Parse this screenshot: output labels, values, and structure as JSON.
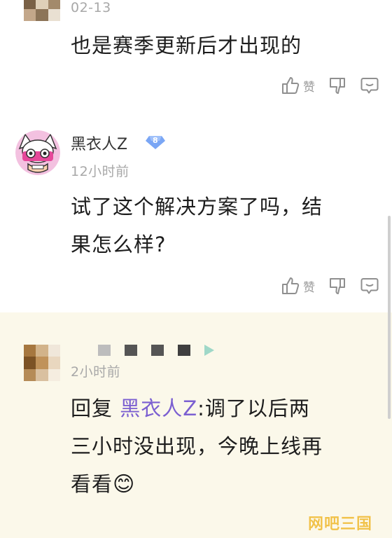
{
  "comments": [
    {
      "time": "02-13",
      "text": "也是赛季更新后才出现的",
      "actions": {
        "like_label": "赞"
      }
    },
    {
      "username": "黑衣人Z",
      "level": "8",
      "time": "12小时前",
      "text_line1": "试了这个解决方案了吗，结",
      "text_line2": "果怎么样?",
      "actions": {
        "like_label": "赞"
      }
    },
    {
      "time": "2小时前",
      "reply_prefix": "回复 ",
      "mention": "黑衣人Z",
      "text_line1_rest": ":调了以后两",
      "text_line2": "三小时没出现，今晚上线再",
      "text_line3": "看看",
      "emoji": "😊"
    }
  ],
  "watermark": "网吧三国",
  "colors": {
    "highlight_bg": "#fbf8ea",
    "mention": "#7b5fd1",
    "muted": "#a8a8a8",
    "badge": "#7aa6f5"
  },
  "icons": [
    "thumb-up-icon",
    "thumb-down-icon",
    "comment-icon",
    "level-badge-icon"
  ]
}
